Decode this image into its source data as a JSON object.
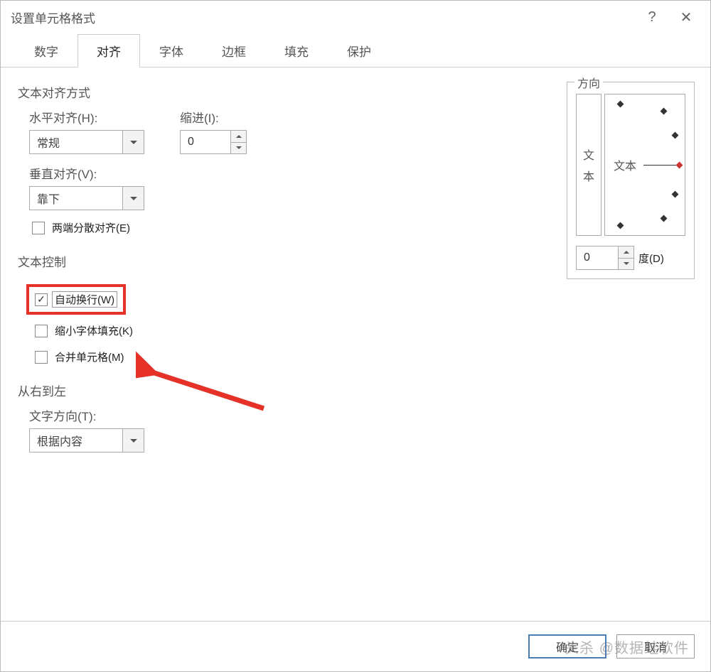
{
  "title": "设置单元格格式",
  "help_glyph": "?",
  "close_glyph": "✕",
  "tabs": [
    "数字",
    "对齐",
    "字体",
    "边框",
    "填充",
    "保护"
  ],
  "active_tab": 1,
  "alignment": {
    "section_label": "文本对齐方式",
    "horizontal_label": "水平对齐(H):",
    "horizontal_value": "常规",
    "indent_label": "缩进(I):",
    "indent_value": "0",
    "vertical_label": "垂直对齐(V):",
    "vertical_value": "靠下",
    "justify_label": "两端分散对齐(E)"
  },
  "textcontrol": {
    "section_label": "文本控制",
    "wrap_label": "自动换行(W)",
    "shrink_label": "缩小字体填充(K)",
    "merge_label": "合并单元格(M)"
  },
  "rtl": {
    "section_label": "从右到左",
    "dir_label": "文字方向(T):",
    "dir_value": "根据内容"
  },
  "orientation": {
    "legend": "方向",
    "vert_char1": "文",
    "vert_char2": "本",
    "dial_label": "文本",
    "degree_value": "0",
    "degree_label": "度(D)"
  },
  "buttons": {
    "ok": "确定",
    "cancel": "取消"
  },
  "watermark_prefix": "头杀 @",
  "watermark_name": "数据蛙软件",
  "check_glyph": "✓"
}
